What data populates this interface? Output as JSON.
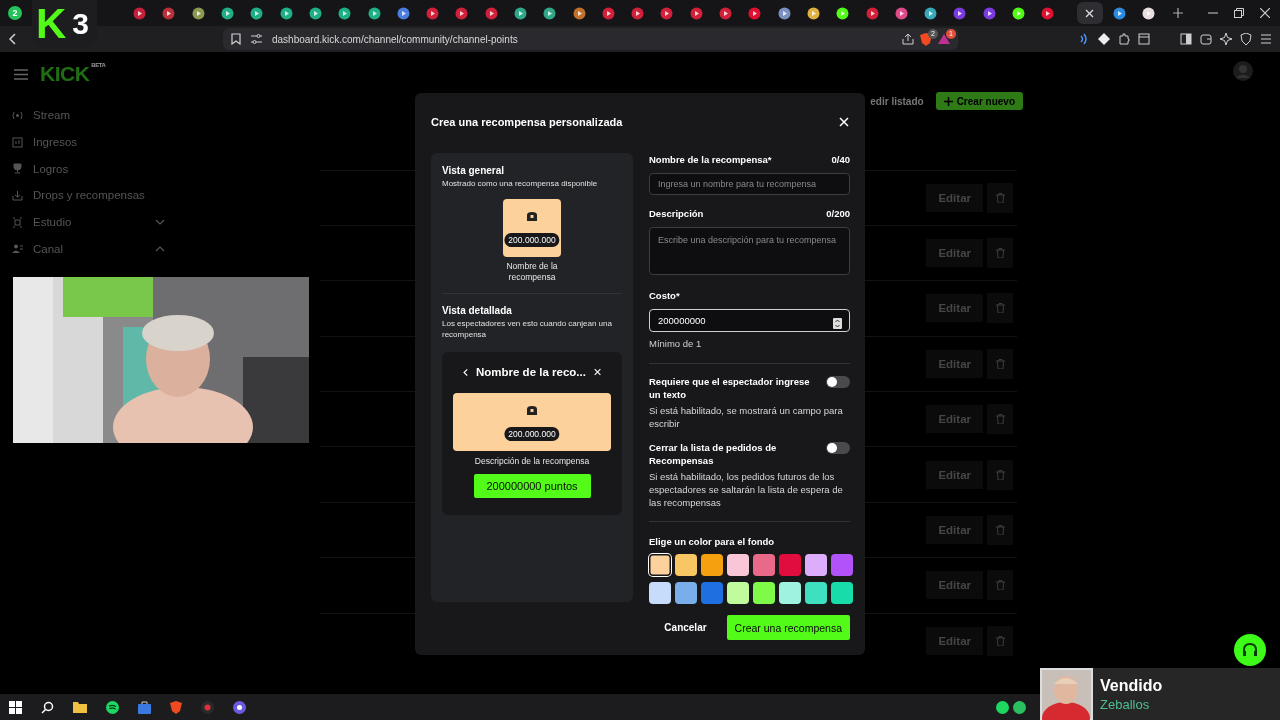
{
  "browser": {
    "pinned_badge": "2",
    "url": "dashboard.kick.com/channel/community/channel-points",
    "shield_badge": "2",
    "rewards_badge": "1"
  },
  "stream_overlay": {
    "logo": "K",
    "count": "3"
  },
  "sidebar": {
    "logo": "KICK",
    "logo_tag": "BETA",
    "items": [
      {
        "kind": "link",
        "label": "Stream"
      },
      {
        "kind": "link",
        "label": "Ingresos"
      },
      {
        "kind": "link",
        "label": "Logros"
      },
      {
        "kind": "link",
        "label": "Drops y recompensas"
      },
      {
        "kind": "group",
        "label": "Estudio",
        "expanded": false
      },
      {
        "kind": "group",
        "label": "Canal",
        "expanded": true
      }
    ]
  },
  "dashboard": {
    "secondary_action": "edir listado",
    "create_button": "Crear nuevo",
    "rows": [
      {
        "edit": "Editar"
      },
      {
        "edit": "Editar"
      },
      {
        "edit": "Editar"
      },
      {
        "edit": "Editar"
      },
      {
        "edit": "Editar"
      },
      {
        "edit": "Editar"
      },
      {
        "edit": "Editar"
      },
      {
        "edit": "Editar"
      },
      {
        "edit": "Editar"
      }
    ]
  },
  "modal": {
    "title": "Crea una recompensa personalizada",
    "overview": {
      "title": "Vista general",
      "subtitle": "Mostrado como una recompensa disponible",
      "cost": "200.000.000",
      "name": "Nombre de la recompensa"
    },
    "detail": {
      "title": "Vista detallada",
      "subtitle": "Los espectadores ven esto cuando canjean una recompensa",
      "header": "Nombre de la reco...",
      "cost": "200.000.000",
      "description": "Descripción de la recompensa",
      "redeem_button": "200000000 puntos"
    },
    "name_field": {
      "label": "Nombre de la recompensa*",
      "counter": "0/40",
      "placeholder": "Ingresa un nombre para tu recompensa"
    },
    "description_field": {
      "label": "Descripción",
      "counter": "0/200",
      "placeholder": "Escribe una descripción para tu recompensa"
    },
    "cost_field": {
      "label": "Costo*",
      "value": "200000000",
      "hint": "Mínimo de 1"
    },
    "toggles": [
      {
        "label": "Requiere que el espectador ingrese un texto",
        "hint": "Si está habilitado, se mostrará un campo para escribir",
        "on": false
      },
      {
        "label": "Cerrar la lista de pedidos de Recompensas",
        "hint": "Si está habilitado, los pedidos futuros de los espectadores se saltarán la lista de espera de las recompensas",
        "on": false
      }
    ],
    "color_label": "Elige un color para el fondo",
    "colors": [
      {
        "color": "#fcd19c",
        "selected": true
      },
      {
        "color": "#f8c662",
        "selected": false
      },
      {
        "color": "#f5a10f",
        "selected": false
      },
      {
        "color": "#f9c6d7",
        "selected": false
      },
      {
        "color": "#e8698a",
        "selected": false
      },
      {
        "color": "#e00d3e",
        "selected": false
      },
      {
        "color": "#dcadfb",
        "selected": false
      },
      {
        "color": "#b253fa",
        "selected": false
      },
      {
        "color": "#c7dcfa",
        "selected": false
      },
      {
        "color": "#7aaeea",
        "selected": false
      },
      {
        "color": "#1f6fe0",
        "selected": false
      },
      {
        "color": "#c0fb9d",
        "selected": false
      },
      {
        "color": "#7efa48",
        "selected": false
      },
      {
        "color": "#a0f2e0",
        "selected": false
      },
      {
        "color": "#3ee0c0",
        "selected": false
      },
      {
        "color": "#17ddab",
        "selected": false
      }
    ],
    "cancel_button": "Cancelar",
    "create_button": "Crear una recompensa"
  },
  "now_playing": {
    "title": "Vendido",
    "artist": "Zeballos"
  }
}
